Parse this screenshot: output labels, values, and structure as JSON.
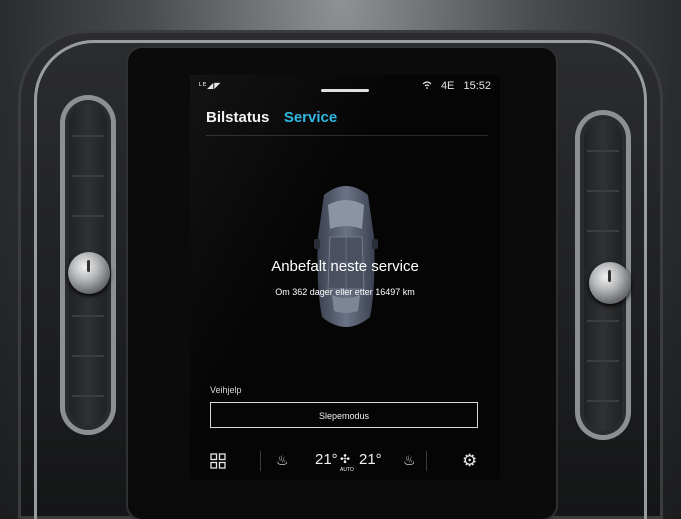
{
  "status_bar": {
    "left_icons": "ᴸᴱ◢◤",
    "wifi_icon": "wifi-icon",
    "network": "4E",
    "time": "15:52"
  },
  "tabs": [
    {
      "label": "Bilstatus",
      "active": false
    },
    {
      "label": "Service",
      "active": true
    }
  ],
  "colors": {
    "accent": "#2bb7e2",
    "background": "#050506",
    "text": "#ffffff"
  },
  "service": {
    "title": "Anbefalt neste service",
    "subtitle": "Om 362 dager eller etter 16497 km"
  },
  "roadside": {
    "section_label": "Veihjelp",
    "tow_button_label": "Slepemodus"
  },
  "climate": {
    "left_temp": "21°",
    "right_temp": "21°",
    "fan_mode": "AUTO",
    "icons": [
      "apps-grid-icon",
      "seat-heat-left-icon",
      "fan-icon",
      "seat-heat-right-icon",
      "settings-gear-icon"
    ]
  }
}
